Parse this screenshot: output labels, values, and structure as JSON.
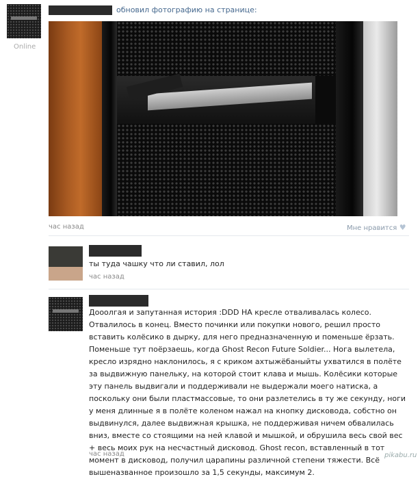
{
  "post": {
    "status": "Online",
    "action_text": "обновил фотографию на странице:",
    "time": "час назад",
    "like_label": "Мне нравится",
    "like_icon": "heart-icon"
  },
  "comments": [
    {
      "text": "ты туда чашку что ли ставил, лол",
      "time": "час назад"
    },
    {
      "text": "Дооолгая и запутанная история :DDD НА кресле отваливалась колесо. Отвалилось в конец. Вместо починки или покупки нового, решил просто вставить колёсико в дырку, для него предназначенную и поменьше ёрзать. Поменьше тут поёрзаешь, когда Ghost Recon Future Soldier... Нога вылетела, кресло изрядно наклонилось, я с криком ахтыжёбаныйты ухватился в полёте за выдвижную панельку, на которой стоит клава и мышь. Колёсики которые эту панель выдвигали и поддерживали не выдержали моего натиска, а поскольку они были пластмассовые, то они разлетелись в ту же секунду, ноги у меня длинные я в полёте коленом нажал на кнопку дисковода, собстно он выдвинулся, далее выдвижная крышка, не поддерживая ничем обвалилась вниз, вместе со стоящими на ней клавой и мышкой, и обрушила весь свой вес + весь моих рук на несчастный дисковод. Ghost recon, вставленный в тот момент в дисковод, получил царапины различной степени тяжести. Всё вышеназванное произошло за 1,5 секунды, максимум 2.",
      "time": "час назад"
    }
  ],
  "watermark": "pikabu.ru"
}
